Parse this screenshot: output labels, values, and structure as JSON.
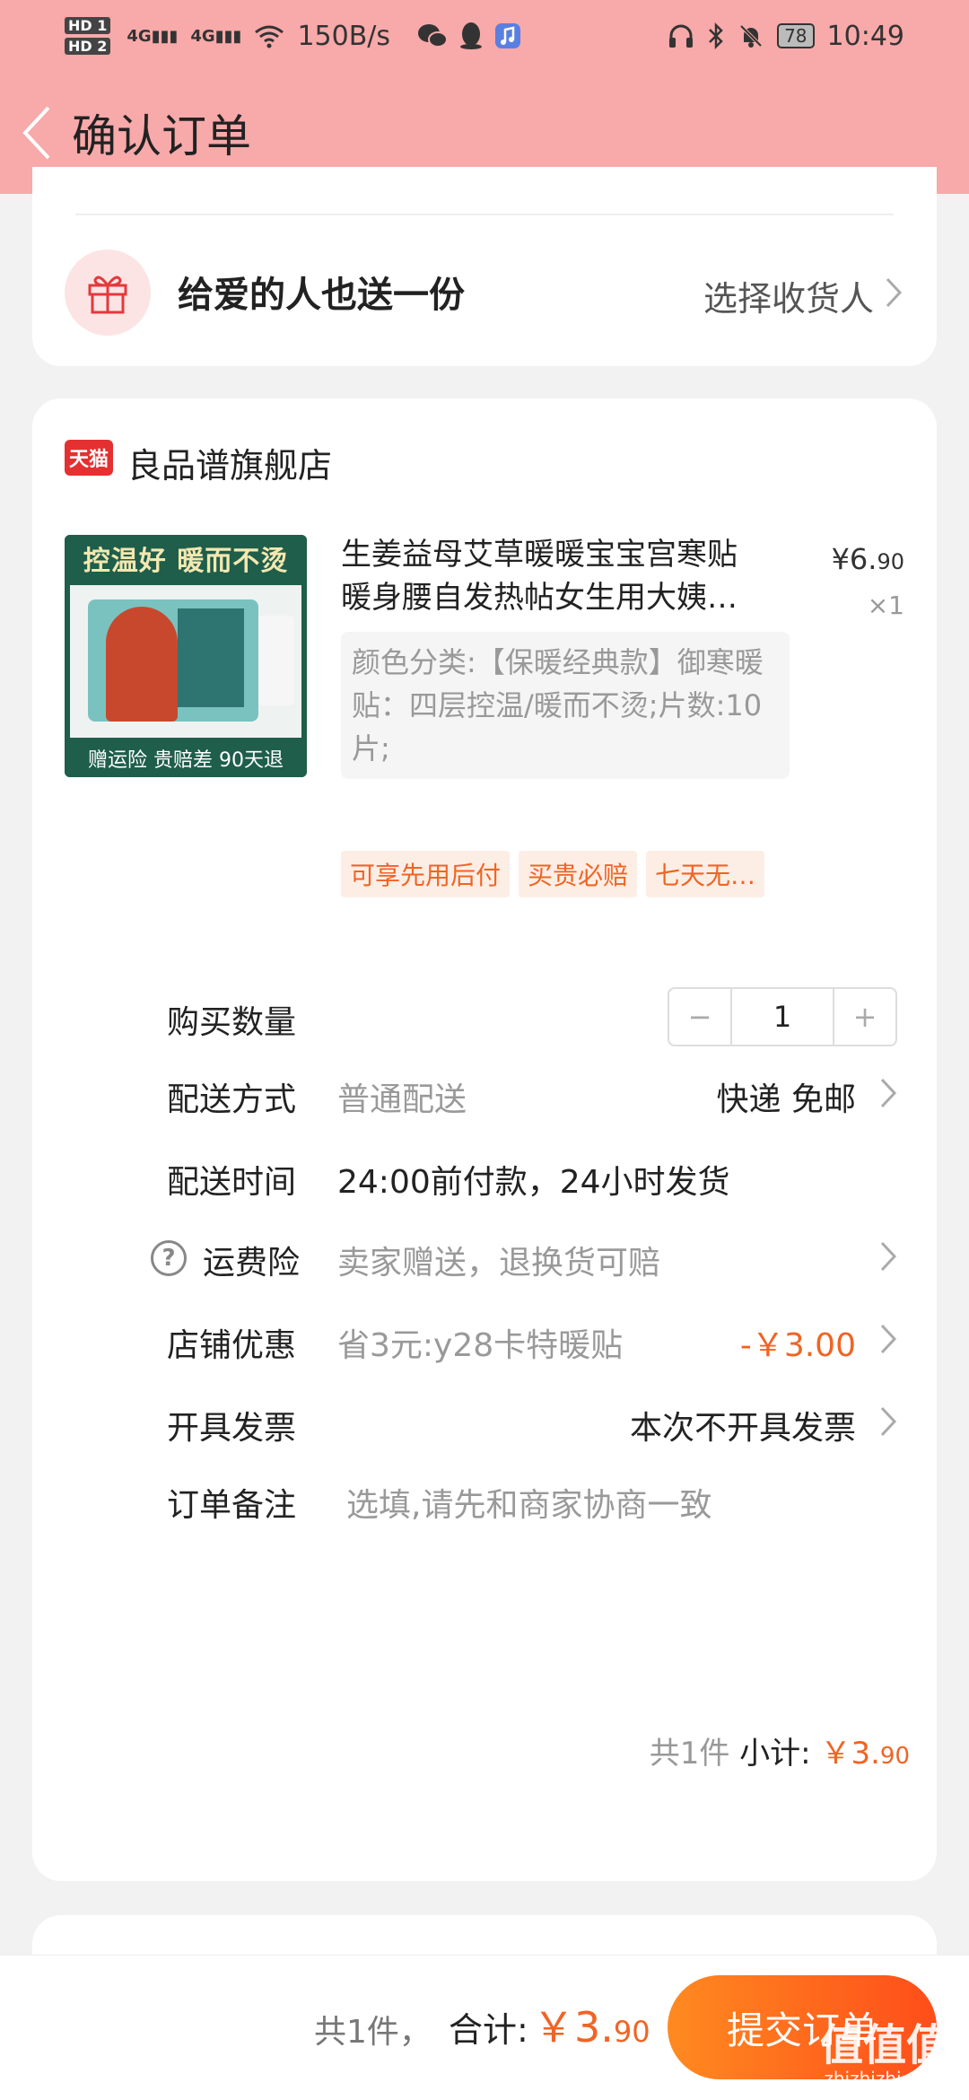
{
  "statusbar": {
    "hd1": "HD 1",
    "hd2": "HD 2",
    "signal1": "4G",
    "signal2": "4G",
    "network_speed": "150B/s",
    "battery": "78",
    "time": "10:49"
  },
  "header": {
    "title": "确认订单"
  },
  "gift": {
    "text": "给爱的人也送一份",
    "action": "选择收货人"
  },
  "shop": {
    "badge": "天猫",
    "name": "良品谱旗舰店"
  },
  "product": {
    "image_top": "控温好 暖而不烫",
    "image_bottom": "赠运险 贵赔差 90天退",
    "title": "生姜益母艾草暖暖宝宝宫寒贴暖身腰自发热帖女生用大姨…",
    "price_int": "¥6.",
    "price_dec": "90",
    "qty": "×1",
    "spec": "颜色分类:【保暖经典款】御寒暖贴：四层控温/暖而不烫;片数:10片;"
  },
  "tags": [
    "可享先用后付",
    "买贵必赔",
    "七天无…"
  ],
  "rows": {
    "quantity": {
      "label": "购买数量",
      "minus": "−",
      "value": "1",
      "plus": "+"
    },
    "delivery": {
      "label": "配送方式",
      "value": "普通配送",
      "right": "快递 免邮"
    },
    "delivery_time": {
      "label": "配送时间",
      "value": "24:00前付款，24小时发货"
    },
    "insurance": {
      "label": "运费险",
      "value": "卖家赠送，退换货可赔",
      "icon": "?"
    },
    "discount": {
      "label": "店铺优惠",
      "value": "省3元:y28卡特暖贴",
      "right": "-￥3.00"
    },
    "invoice": {
      "label": "开具发票",
      "right": "本次不开具发票"
    },
    "note": {
      "label": "订单备注",
      "placeholder": "选填,请先和商家协商一致"
    }
  },
  "subtotal": {
    "count": "共1件",
    "label": "小计:",
    "price_int": "￥3.",
    "price_dec": "90"
  },
  "bottom": {
    "count": "共1件，",
    "label": "合计:",
    "price_int": "￥3.",
    "price_dec": "90",
    "submit": "提交订单"
  },
  "watermark": {
    "big": "值值值",
    "small": "zhizhizhi.com"
  },
  "colors": {
    "header_bg": "#f8a9a9",
    "accent": "#f06424",
    "submit_start": "#ff8a20",
    "submit_end": "#ff4d1a"
  }
}
